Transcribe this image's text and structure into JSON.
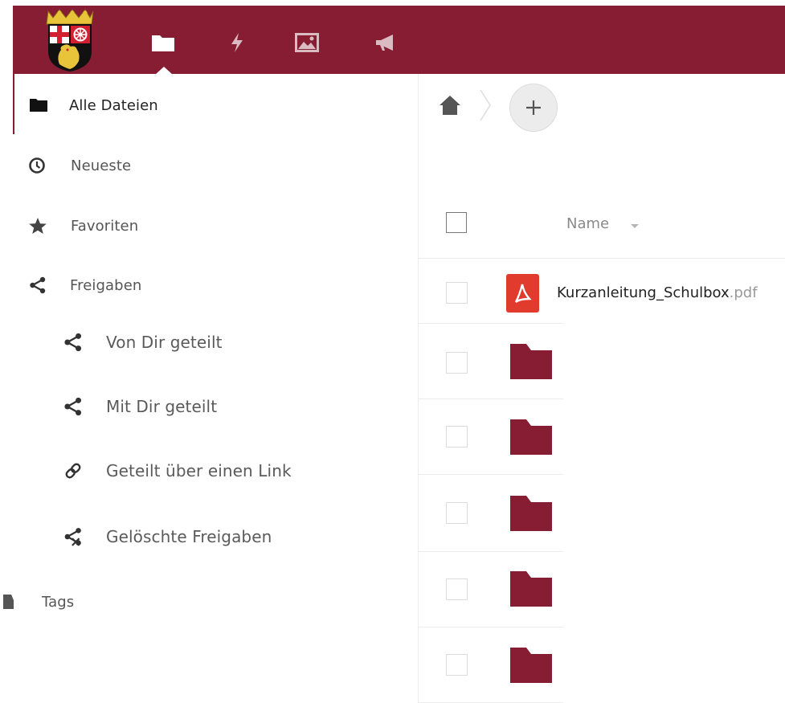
{
  "theme": {
    "brand": "#861d33",
    "pdf_red": "#e13b2d",
    "folder_red": "#861d33"
  },
  "header": {
    "logo": "state-coat-of-arms",
    "apps": [
      {
        "id": "files",
        "icon": "folder-icon",
        "active": true
      },
      {
        "id": "activity",
        "icon": "lightning-icon",
        "active": false
      },
      {
        "id": "gallery",
        "icon": "image-icon",
        "active": false
      },
      {
        "id": "announcements",
        "icon": "megaphone-icon",
        "active": false
      }
    ]
  },
  "sidebar": {
    "items": [
      {
        "id": "all-files",
        "label": "Alle Dateien",
        "icon": "folder-icon",
        "active": true
      },
      {
        "id": "recent",
        "label": "Neueste",
        "icon": "clock-icon"
      },
      {
        "id": "favorites",
        "label": "Favoriten",
        "icon": "star-icon"
      },
      {
        "id": "shares",
        "label": "Freigaben",
        "icon": "share-icon"
      },
      {
        "id": "shared-by-you",
        "label": "Von Dir geteilt",
        "icon": "share-icon",
        "sub": true
      },
      {
        "id": "shared-with-you",
        "label": "Mit Dir geteilt",
        "icon": "share-icon",
        "sub": true
      },
      {
        "id": "shared-by-link",
        "label": "Geteilt über einen Link",
        "icon": "link-icon",
        "sub": true
      },
      {
        "id": "deleted-shares",
        "label": "Gelöschte Freigaben",
        "icon": "deleted-share-icon",
        "sub": true
      },
      {
        "id": "tags",
        "label": "Tags",
        "icon": "tag-icon"
      }
    ]
  },
  "breadcrumb": {
    "home_icon": "home-icon",
    "add_icon": "plus-icon"
  },
  "filelist": {
    "column_name": "Name",
    "files": [
      {
        "type": "pdf",
        "basename": "Kurzanleitung_Schulbox",
        "extension": ".pdf"
      },
      {
        "type": "folder",
        "basename": "",
        "extension": ""
      },
      {
        "type": "folder",
        "basename": "",
        "extension": ""
      },
      {
        "type": "folder",
        "basename": "",
        "extension": ""
      },
      {
        "type": "folder",
        "basename": "",
        "extension": ""
      },
      {
        "type": "folder",
        "basename": "",
        "extension": ""
      }
    ]
  }
}
